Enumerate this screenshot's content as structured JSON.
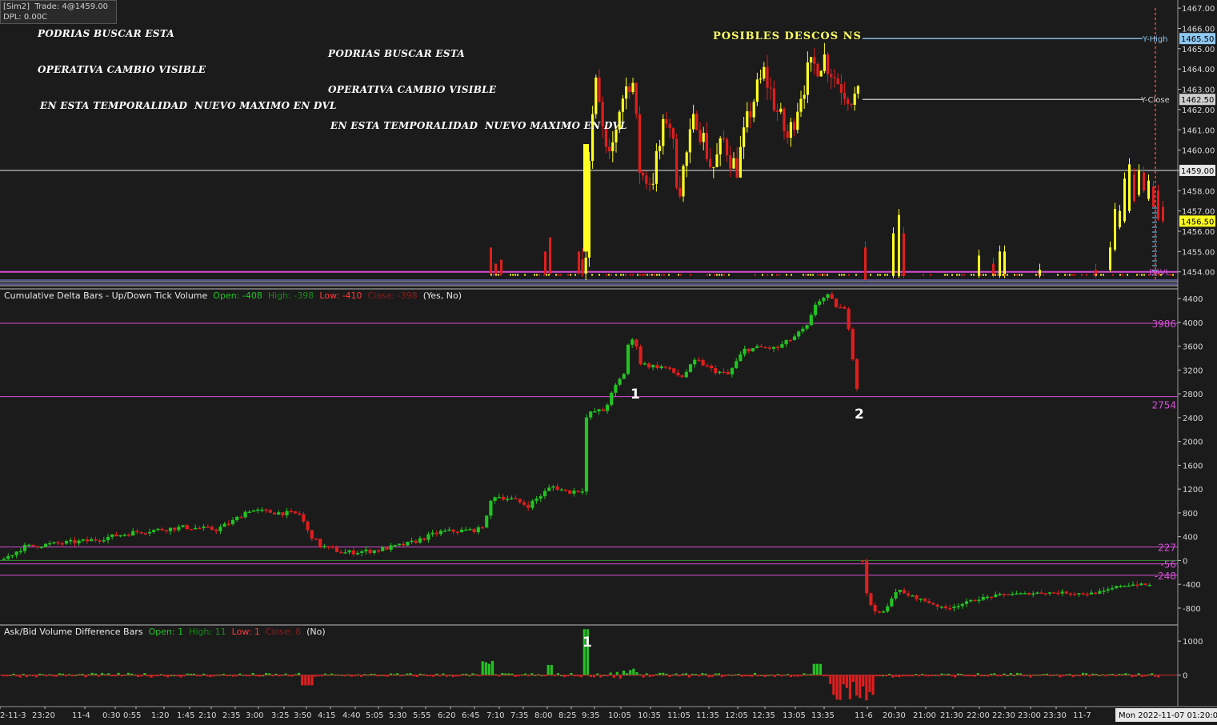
{
  "header": {
    "account": "[Sim2]",
    "trade": "Trade: 4@1459.00",
    "dpl": "DPL: 0.00C"
  },
  "annotations": {
    "left_lines": [
      "PODRIAS BUSCAR ESTA",
      "OPERATIVA CAMBIO VISIBLE",
      "EN ESTA TEMPORALIDAD  NUEVO MAXIMO EN DVL"
    ],
    "mid_lines": [
      "PODRIAS BUSCAR ESTA",
      "OPERATIVA CAMBIO VISIBLE",
      "EN ESTA TEMPORALIDAD  NUEVO MAXIMO EN DVL"
    ],
    "yellow": "POSIBLES DESCOS NS",
    "marker_1": "1",
    "marker_2": "2",
    "marker_1b": "1"
  },
  "colors": {
    "bg": "#1b1b1b",
    "up": "#22c322",
    "down": "#e01e1e",
    "price_up": "#ffff22",
    "price_down": "#e01e1e",
    "magenta": "#d64fd6",
    "grid_line": "#ffffff"
  },
  "chart_data": [
    {
      "type": "candlestick",
      "panel": "price",
      "yticks": [
        1467,
        1466,
        1465,
        1464,
        1463,
        1462,
        1461,
        1460,
        1459,
        1458,
        1457,
        1456,
        1455,
        1454
      ],
      "ytick_labels": [
        "1467.00",
        "1466.00",
        "1465.00",
        "1464.00",
        "1463.00",
        "1462.00",
        "1461.00",
        "1460.00",
        "1459.00",
        "1458.00",
        "1457.00",
        "1456.00",
        "1455.00",
        "1454.00"
      ],
      "ylim": [
        1453.2,
        1467.4
      ],
      "levels": {
        "y_high": 1465.5,
        "y_close": 1462.5,
        "trade": 1459.0,
        "last": 1456.5,
        "dvl": 1454.0
      },
      "level_labels": {
        "y_high": "Y-High",
        "y_high_price": "1465.50",
        "y_close": "Y-Close",
        "y_close_price": "1462.50",
        "trade_price": "1459.00",
        "last_price": "1456.50",
        "dvl": "DAVL"
      }
    },
    {
      "type": "candlestick",
      "panel": "cumulative_delta",
      "title": "Cumulative Delta Bars - Up/Down Tick Volume",
      "stats": {
        "open_label": "Open: -408",
        "high_label": "High: -398",
        "low_label": "Low: -410",
        "close_label": "Close: -398",
        "params": "(Yes, No)"
      },
      "yticks": [
        4400,
        4000,
        3600,
        3200,
        2800,
        2400,
        2000,
        1600,
        1200,
        800,
        400,
        0,
        -400,
        -800
      ],
      "ytick_labels": [
        "4400",
        "4000",
        "3600",
        "3200",
        "2800",
        "2400",
        "2000",
        "1600",
        "1200",
        "800",
        "400",
        "0",
        "-400",
        "-800"
      ],
      "ylim": [
        -1070,
        4550
      ],
      "ref_lines": [
        3986,
        2754,
        227,
        -56,
        -248
      ],
      "ref_labels": [
        "3986",
        "2754",
        "227",
        "-56",
        "-248"
      ]
    },
    {
      "type": "bar",
      "panel": "ask_bid_difference",
      "title": "Ask/Bid Volume Difference Bars",
      "stats": {
        "open_label": "Open: 1",
        "high_label": "High: 11",
        "low_label": "Low: 1",
        "close_label": "Close: 8",
        "params": "(No)"
      },
      "yticks": [
        1000,
        0
      ],
      "ytick_labels": [
        "1000",
        "0"
      ],
      "ylim": [
        -900,
        1450
      ]
    },
    {
      "type": "time_axis",
      "labels": [
        "2-11-3",
        "23:20",
        "11-4",
        "0:30",
        "0:55",
        "1:20",
        "1:45",
        "2:10",
        "2:35",
        "3:00",
        "3:25",
        "3:50",
        "4:15",
        "4:40",
        "5:05",
        "5:30",
        "5:55",
        "6:20",
        "6:45",
        "7:10",
        "7:35",
        "8:00",
        "8:25",
        "9:35",
        "10:05",
        "10:35",
        "11:05",
        "11:35",
        "12:05",
        "12:35",
        "13:05",
        "13:35",
        "11-6",
        "20:30",
        "21:00",
        "21:30",
        "22:00",
        "22:30",
        "23:00",
        "23:30",
        "11-7"
      ],
      "current": "Mon 2022-11-07  01:20:0"
    }
  ]
}
